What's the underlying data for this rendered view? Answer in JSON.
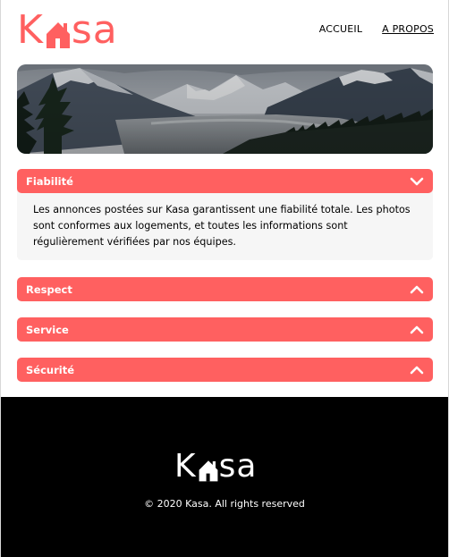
{
  "brand": {
    "logo_k": "K",
    "logo_sa": "sa",
    "accent_color": "#ff6060"
  },
  "nav": {
    "items": [
      {
        "label": "ACCUEIL",
        "active": false
      },
      {
        "label": "A PROPOS",
        "active": true
      }
    ]
  },
  "banner": {
    "image": "mountain-landscape"
  },
  "collapses": [
    {
      "title": "Fiabilité",
      "expanded": true,
      "icon": "chevron-down-icon",
      "text": "Les annonces postées sur Kasa garantissent une fiabilité totale. Les photos sont conformes aux logements, et toutes les informations sont régulièrement vérifiées par nos équipes."
    },
    {
      "title": "Respect",
      "expanded": false,
      "icon": "chevron-up-icon"
    },
    {
      "title": "Service",
      "expanded": false,
      "icon": "chevron-up-icon"
    },
    {
      "title": "Sécurité",
      "expanded": false,
      "icon": "chevron-up-icon"
    }
  ],
  "footer": {
    "logo_k": "K",
    "logo_sa": "sa",
    "copyright": "© 2020 Kasa. All rights reserved"
  }
}
